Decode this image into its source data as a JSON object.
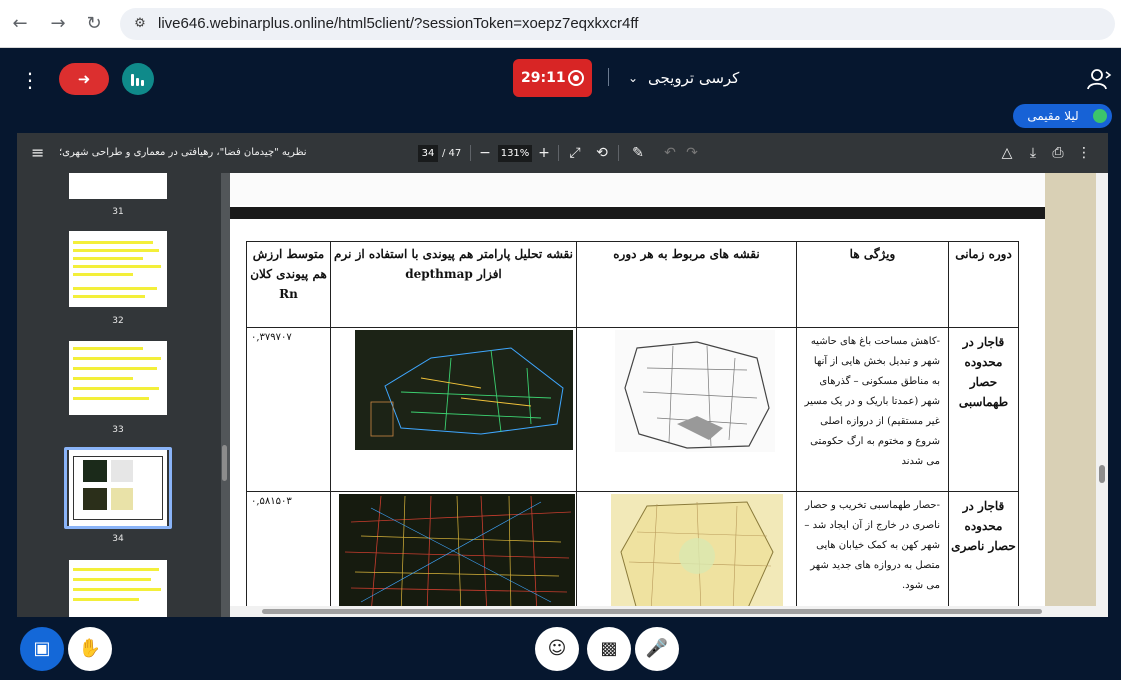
{
  "browser": {
    "url": "live646.webinarplus.online/html5client/?sessionToken=xoepz7eqxkxcr4ff"
  },
  "meeting": {
    "timer": "29:11",
    "room_name": "کرسی ترویجی",
    "speaker": "لیلا مقیمی"
  },
  "pdf": {
    "title": "نظریه \"چیدمان فضا\"، رهیافتی در معماری و طراحی شهری؛",
    "current_page": "34",
    "total_pages": "/ 47",
    "zoom": "131%",
    "thumbnails": [
      "31",
      "32",
      "33",
      "34"
    ]
  },
  "table": {
    "headers": {
      "era": "دوره زمانی",
      "features": "ویژگی ها",
      "maps": "نقشه های مربوط به هر دوره",
      "analysis": "نقشه تحلیل پارامتر هم پیوندی با استفاده از نرم افزار depthmap",
      "avg": "متوسط ارزش هم پیوندی کلان Rn"
    },
    "rows": [
      {
        "era": "قاجار در محدوده حصار طهماسبی",
        "features": "-کاهش مساحت باغ های حاشیه شهر و تبدیل بخش هایی از آنها به مناطق مسکونی – گذرهای شهر (عمدتا باریک و در یک مسیر غیر مستقیم) از دروازه اصلی شروع و مختوم به ارگ حکومتی می شدند",
        "value": "۰,۳۷۹۷۰۷"
      },
      {
        "era": "قاجار در محدوده حصار ناصری",
        "features": "-حصار طهماسبی تخریب و حصار ناصری در خارج از آن ایجاد شد – شهر کهن به کمک خیابان هایی متصل به دروازه های جدید شهر می شود.",
        "value": "۰,۵۸۱۵۰۳"
      }
    ]
  },
  "colors": {
    "record": "#d82525",
    "leave": "#dc2f2f",
    "accent": "#1468d8",
    "highlight": "#f3ef3a"
  },
  "icons": [
    "back-icon",
    "forward-icon",
    "reload-icon",
    "site-settings-icon",
    "menu-icon",
    "leave-icon",
    "stats-icon",
    "record-icon",
    "chevron-down-icon",
    "user-icon",
    "mic-icon",
    "sidebar-icon",
    "zoom-out-icon",
    "zoom-in-icon",
    "fit-icon",
    "rotate-icon",
    "annotate-icon",
    "undo-icon",
    "redo-icon",
    "drive-icon",
    "download-icon",
    "print-icon",
    "more-icon",
    "screen-share-icon",
    "raise-hand-icon",
    "emoji-icon",
    "camera-off-icon",
    "mic-off-icon"
  ]
}
